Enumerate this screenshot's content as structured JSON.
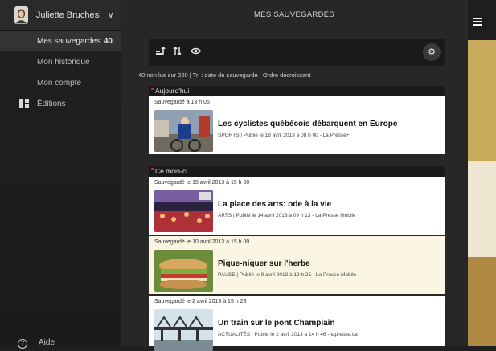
{
  "user": {
    "name": "Juliette Bruchesi"
  },
  "sidebar": {
    "items": [
      {
        "label": "Mes sauvegardes",
        "count": "40"
      },
      {
        "label": "Mon historique"
      },
      {
        "label": "Mon compte"
      },
      {
        "label": "Éditions"
      }
    ],
    "help": "Aide"
  },
  "header": {
    "title": "MES SAUVEGARDES"
  },
  "status": "40 non lus sur 220  |  Tri : date de sauvegarde  |  Ordre décroissant",
  "sections": [
    {
      "label": "Aujourd'hui"
    },
    {
      "label": "Ce mois-ci"
    }
  ],
  "articles": [
    {
      "saved": "Sauvegardé à 13 h 05",
      "title": "Les cyclistes québécois débarquent en Europe",
      "category": "SPORTS",
      "published": "Publié le 18 avril 2013 à 08 h 00 - La Presse+"
    },
    {
      "saved": "Sauvegardé le 15 avril 2013 à 15 h 00",
      "title": "La place des arts: ode à la vie",
      "category": "ARTS",
      "published": "Publié le 14 avril 2013 à 09 h 13 - La Presse Mobile"
    },
    {
      "saved": "Sauvegardé le 10 avril 2013 à 15 h 00",
      "title": "Pique-niquer sur l'herbe",
      "category": "PAUSE",
      "published": "Publié le 9 avril 2013 à 19 h 25 - La Presse Mobile"
    },
    {
      "saved": "Sauvegardé le 2 avril 2013 à 15 h 23",
      "title": "Un train sur le pont Champlain",
      "category": "ACTUALITÉS",
      "published": "Publié le 2 avril 2013 à 14 h 46 - lapresse.ca"
    }
  ],
  "icons": {
    "toolbar": [
      "sort-icon",
      "filter-icon",
      "view-icon"
    ],
    "settings": "wrench-icon",
    "menu": "hamburger-icon"
  },
  "colors": {
    "section_marker": "#dd2222",
    "highlight_card": "#fbf6e3"
  }
}
